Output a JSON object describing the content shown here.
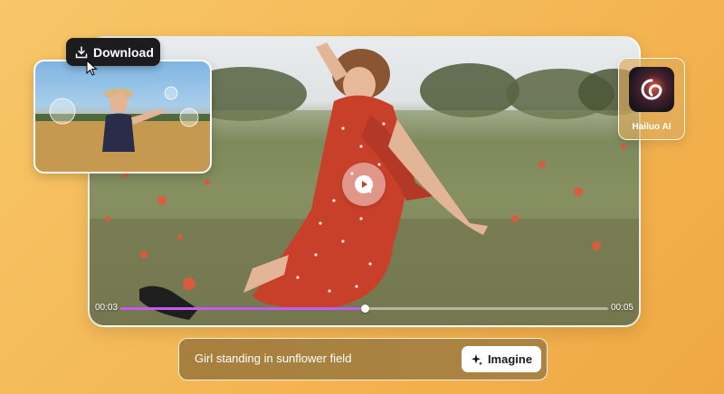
{
  "video": {
    "time_start": "00:03",
    "time_end": "00:05",
    "progress": 0.5,
    "accent_color": "#c05cf0"
  },
  "download": {
    "label": "Download",
    "icon": "download-icon"
  },
  "ai_card": {
    "label": "Hailuo AI",
    "icon": "hailuo-logo-icon"
  },
  "prompt": {
    "text": "Girl standing in sunflower field",
    "button_label": "Imagine",
    "button_icon": "sparkle-icon"
  }
}
